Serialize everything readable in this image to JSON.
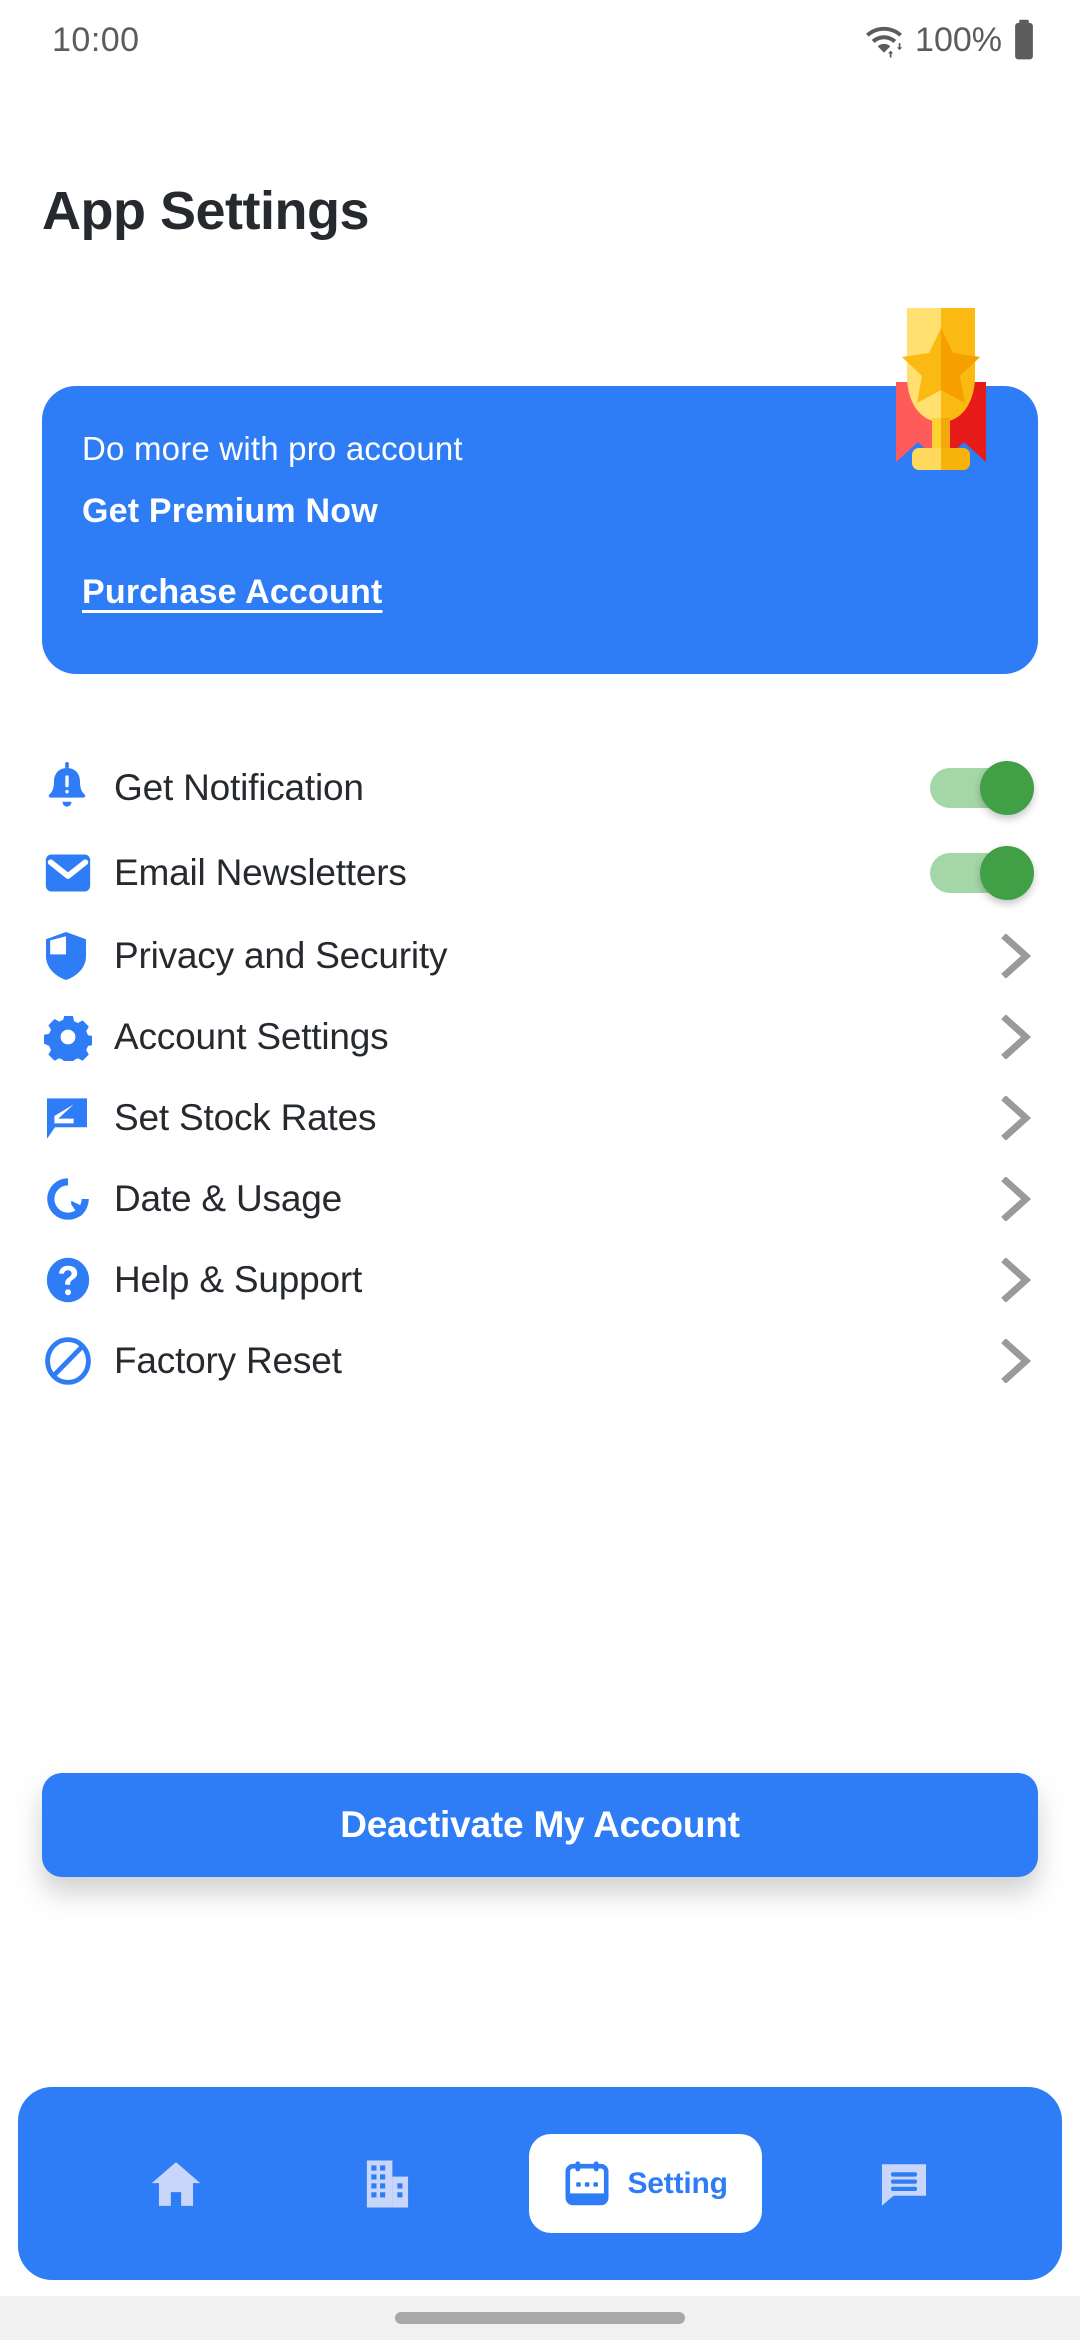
{
  "status_bar": {
    "time": "10:00",
    "battery_text": "100%",
    "wifi_icon": "wifi-arrows-icon",
    "battery_icon": "battery-full-icon"
  },
  "header": {
    "title": "App Settings"
  },
  "promo_banner": {
    "line1": "Do more with pro account",
    "line2": "Get Premium Now",
    "link": "Purchase Account",
    "illustration": "trophy-icon",
    "background_color": "#2E7DF7"
  },
  "settings": {
    "items": [
      {
        "label": "Get Notification",
        "icon": "bell-alert-icon",
        "control": "toggle",
        "toggle_on": true
      },
      {
        "label": "Email Newsletters",
        "icon": "envelope-icon",
        "control": "toggle",
        "toggle_on": true
      },
      {
        "label": "Privacy and Security",
        "icon": "shield-icon",
        "control": "chevron"
      },
      {
        "label": "Account Settings",
        "icon": "gear-icon",
        "control": "chevron"
      },
      {
        "label": "Set Stock Rates",
        "icon": "edit-bubble-icon",
        "control": "chevron"
      },
      {
        "label": "Date & Usage",
        "icon": "donut-chart-icon",
        "control": "chevron"
      },
      {
        "label": "Help & Support",
        "icon": "question-circle-icon",
        "control": "chevron"
      },
      {
        "label": "Factory Reset",
        "icon": "block-circle-icon",
        "control": "chevron"
      }
    ]
  },
  "primary_action": {
    "label": "Deactivate My Account"
  },
  "bottom_nav": {
    "items": [
      {
        "label": "",
        "icon": "home-icon",
        "active": false
      },
      {
        "label": "",
        "icon": "building-icon",
        "active": false
      },
      {
        "label": "Setting",
        "icon": "calendar-icon",
        "active": true
      },
      {
        "label": "",
        "icon": "chat-icon",
        "active": false
      }
    ]
  },
  "colors": {
    "accent_blue": "#2E7DF7",
    "toggle_on": "#41A045",
    "toggle_track": "#A5D6A7",
    "text_primary": "#262A2E",
    "chevron_gray": "#9A9A9A"
  }
}
